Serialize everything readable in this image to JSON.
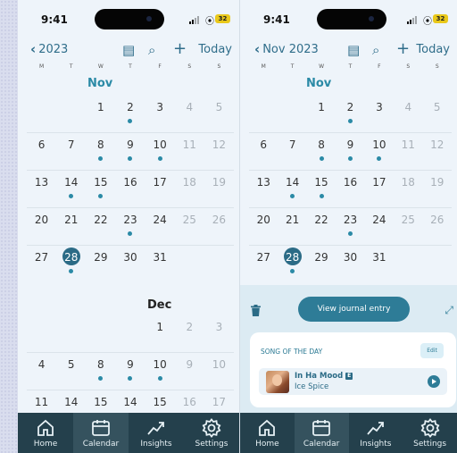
{
  "status": {
    "time": "9:41",
    "battery": "32"
  },
  "colors": {
    "accent": "#2b8aa6",
    "selected": "#2b6b86",
    "tabbar": "#24404c"
  },
  "weekdays": [
    "M",
    "T",
    "W",
    "T",
    "F",
    "S",
    "S"
  ],
  "left": {
    "back_label": "2023",
    "today_label": "Today",
    "month_nov": "Nov",
    "month_dec": "Dec",
    "nov_weeks": [
      [
        "",
        "",
        "1",
        "2",
        "3",
        "4",
        "5"
      ],
      [
        "6",
        "7",
        "8",
        "9",
        "10",
        "11",
        "12"
      ],
      [
        "13",
        "14",
        "15",
        "16",
        "17",
        "18",
        "19"
      ],
      [
        "20",
        "21",
        "22",
        "23",
        "24",
        "25",
        "26"
      ],
      [
        "27",
        "28",
        "29",
        "30",
        "31",
        "",
        ""
      ]
    ],
    "dec_weeks": [
      [
        "",
        "",
        "",
        "",
        "1",
        "2",
        "3"
      ],
      [
        "4",
        "5",
        "8",
        "9",
        "10",
        "9",
        "10"
      ],
      [
        "11",
        "14",
        "15",
        "14",
        "15",
        "16",
        "17"
      ]
    ]
  },
  "right": {
    "back_label": "Nov 2023",
    "today_label": "Today",
    "month_nov": "Nov",
    "nov_weeks": [
      [
        "",
        "",
        "1",
        "2",
        "3",
        "4",
        "5"
      ],
      [
        "6",
        "7",
        "8",
        "9",
        "10",
        "11",
        "12"
      ],
      [
        "13",
        "14",
        "15",
        "16",
        "17",
        "18",
        "19"
      ],
      [
        "20",
        "21",
        "22",
        "23",
        "24",
        "25",
        "26"
      ],
      [
        "27",
        "28",
        "29",
        "30",
        "31",
        "",
        ""
      ]
    ],
    "view_journal_label": "View journal entry",
    "song_card": {
      "title": "SONG OF THE DAY",
      "edit_label": "Edit",
      "song": "In Ha Mood",
      "explicit": "E",
      "artist": "Ice Spice"
    }
  },
  "tabs": [
    {
      "label": "Home",
      "icon": "home-icon"
    },
    {
      "label": "Calendar",
      "icon": "calendar-icon"
    },
    {
      "label": "Insights",
      "icon": "insights-icon"
    },
    {
      "label": "Settings",
      "icon": "settings-icon"
    }
  ]
}
